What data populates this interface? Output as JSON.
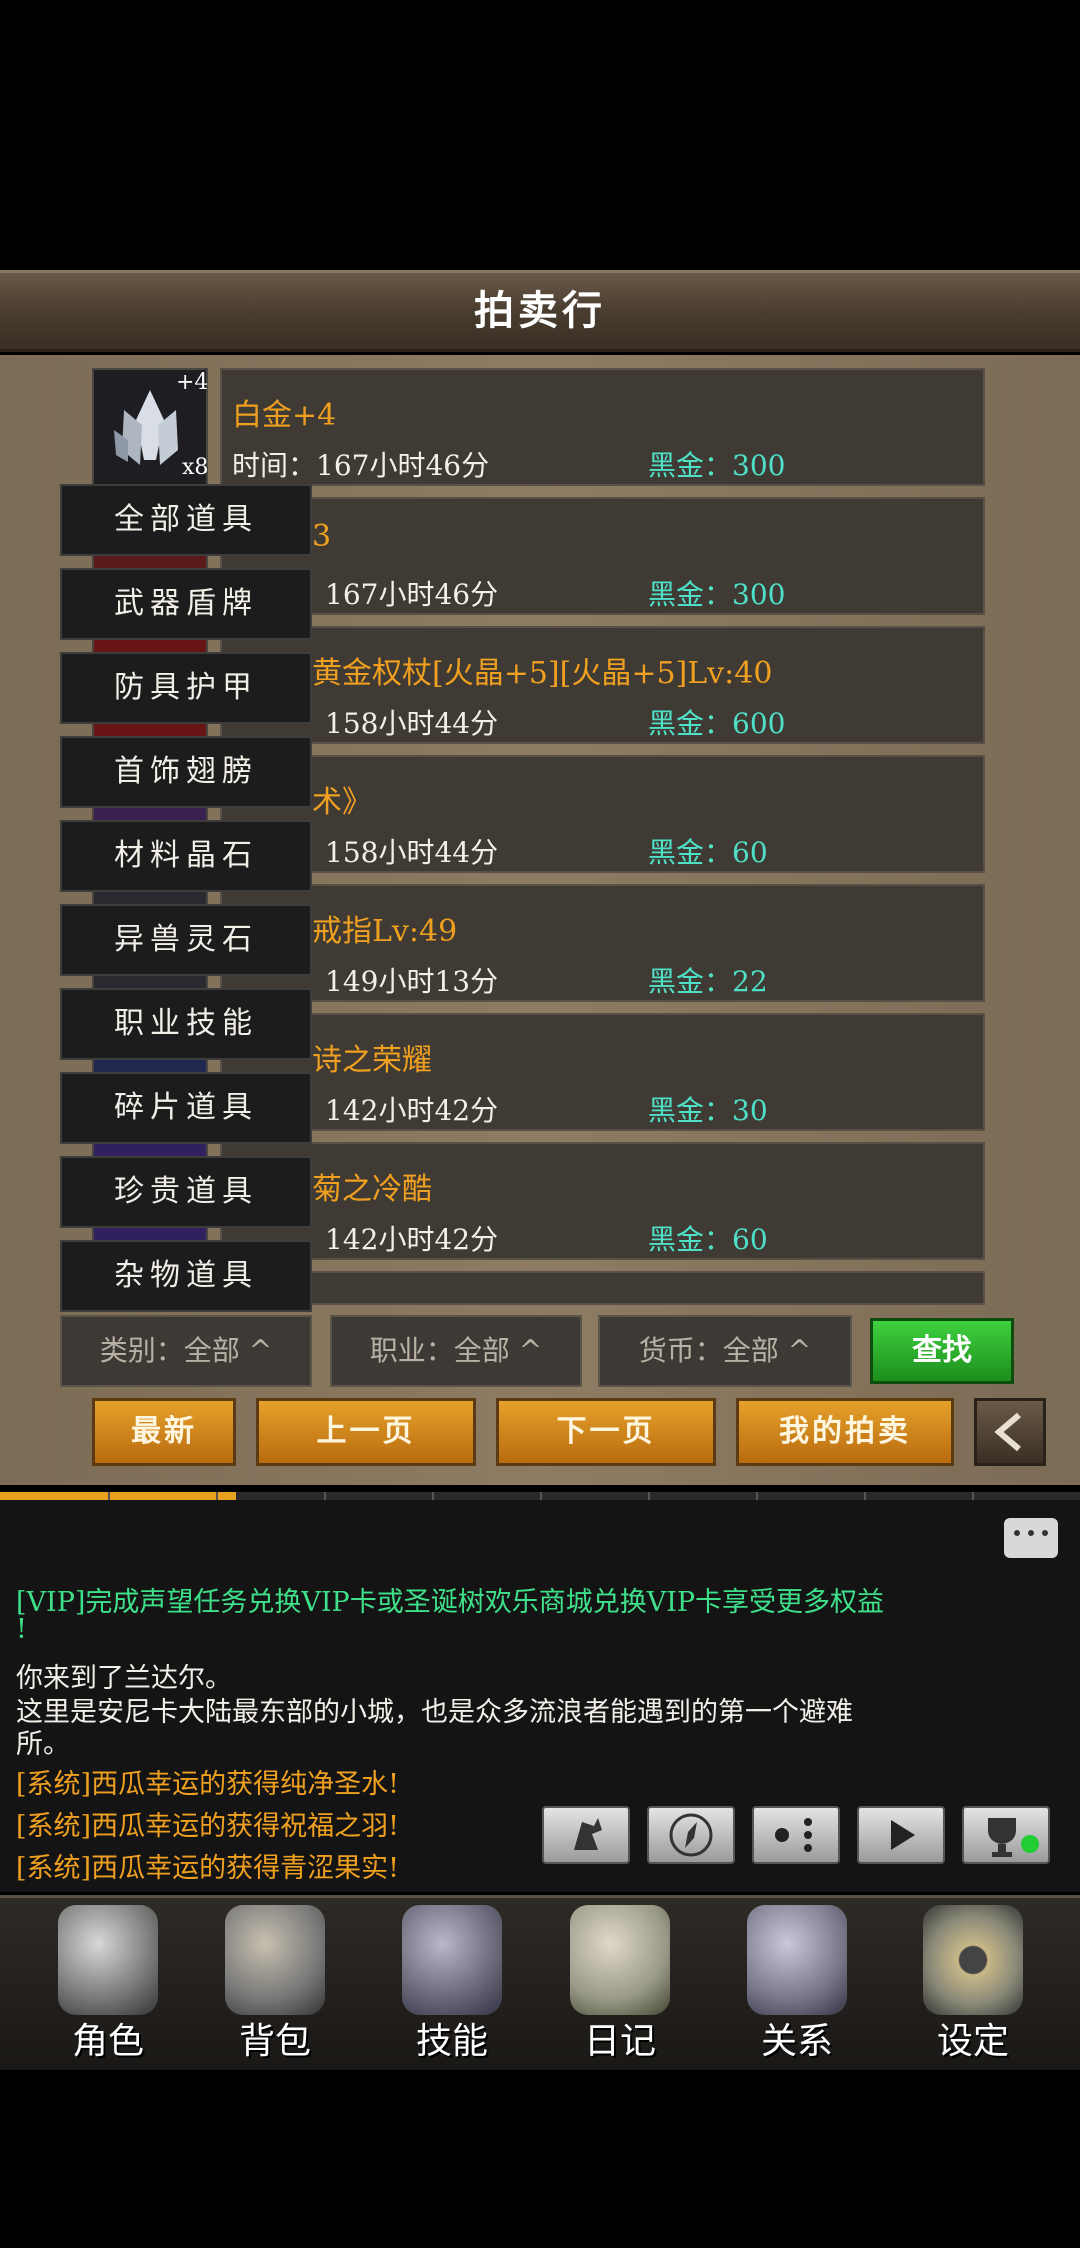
{
  "header": {
    "title": "拍卖行"
  },
  "listings": [
    {
      "name": "白金+4",
      "time": "时间：167小时46分",
      "price": "黑金：300",
      "badge": "+4",
      "qty": "x8",
      "icon": "crystal-icon"
    },
    {
      "name": "3",
      "time": "167小时46分",
      "price": "黑金：300"
    },
    {
      "name": "黄金权杖[火晶+5][火晶+5]Lv:40",
      "time": "158小时44分",
      "price": "黑金：600"
    },
    {
      "name": "术》",
      "time": "158小时44分",
      "price": "黑金：60"
    },
    {
      "name": "戒指Lv:49",
      "time": "149小时13分",
      "price": "黑金：22"
    },
    {
      "name": "诗之荣耀",
      "time": "142小时42分",
      "price": "黑金：30"
    },
    {
      "name": "菊之冷酷",
      "time": "142小时42分",
      "price": "黑金：60"
    }
  ],
  "categories": [
    "全部道具",
    "武器盾牌",
    "防具护甲",
    "首饰翅膀",
    "材料晶石",
    "异兽灵石",
    "职业技能",
    "碎片道具",
    "珍贵道具",
    "杂物道具"
  ],
  "filters": {
    "category": "类别：全部",
    "profession": "职业：全部",
    "currency": "货币：全部",
    "search": "查找"
  },
  "pagination": {
    "newest": "最新",
    "prev": "上一页",
    "next": "下一页",
    "my_auction": "我的拍卖",
    "back_icon": "chevron-left-icon"
  },
  "chat": {
    "vip_line1": "[VIP]完成声望任务兑换VIP卡或圣诞树欢乐商城兑换VIP卡享受更多权益",
    "vip_line2": "!",
    "msg1": "你来到了兰达尔。",
    "msg2": "这里是安尼卡大陆最东部的小城，也是众多流浪者能遇到的第一个避难",
    "msg3": "所。",
    "sys1": "[系统]西瓜幸运的获得纯净圣水!",
    "sys2": "[系统]西瓜幸运的获得祝福之羽!",
    "sys3": "[系统]西瓜幸运的获得青涩果实!"
  },
  "colors": {
    "gold": "#f0a020",
    "price": "#4fe0c8",
    "vip": "#3fe08a",
    "system": "#f0a020",
    "search_green": "#2bb52b"
  },
  "nav": [
    {
      "label": "角色",
      "icon": "helmet-icon"
    },
    {
      "label": "背包",
      "icon": "backpack-icon"
    },
    {
      "label": "技能",
      "icon": "skill-book-icon"
    },
    {
      "label": "日记",
      "icon": "scroll-icon"
    },
    {
      "label": "关系",
      "icon": "handshake-icon"
    },
    {
      "label": "设定",
      "icon": "gear-icon"
    }
  ]
}
